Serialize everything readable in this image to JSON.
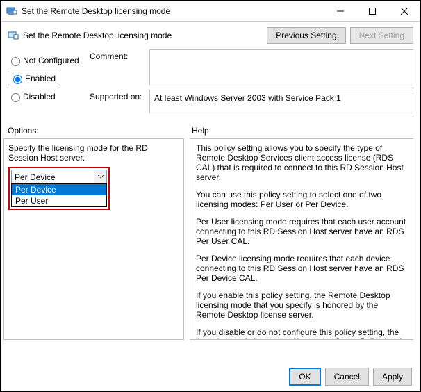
{
  "window": {
    "title": "Set the Remote Desktop licensing mode"
  },
  "header": {
    "subtitle": "Set the Remote Desktop licensing mode",
    "prev_btn": "Previous Setting",
    "next_btn": "Next Setting"
  },
  "radios": {
    "not_configured": "Not Configured",
    "enabled": "Enabled",
    "disabled": "Disabled"
  },
  "labels": {
    "comment": "Comment:",
    "supported": "Supported on:",
    "options": "Options:",
    "help": "Help:"
  },
  "supported_text": "At least Windows Server 2003 with Service Pack 1",
  "options": {
    "instruction": "Specify the licensing mode for the RD Session Host server.",
    "combo_value": "Per Device",
    "dropdown": {
      "opt1": "Per Device",
      "opt2": "Per User"
    }
  },
  "help": {
    "p1": "This policy setting allows you to specify the type of Remote Desktop Services client access license (RDS CAL) that is required to connect to this RD Session Host server.",
    "p2": "You can use this policy setting to select one of two licensing modes: Per User or Per Device.",
    "p3": "Per User licensing mode requires that each user account connecting to this RD Session Host server have an RDS Per User CAL.",
    "p4": "Per Device licensing mode requires that each device connecting to this RD Session Host server have an RDS Per Device CAL.",
    "p5": "If you enable this policy setting, the Remote Desktop licensing mode that you specify is honored by the Remote Desktop license server.",
    "p6": "If you disable or do not configure this policy setting, the licensing mode is not specified at the Group Policy level."
  },
  "buttons": {
    "ok": "OK",
    "cancel": "Cancel",
    "apply": "Apply"
  }
}
